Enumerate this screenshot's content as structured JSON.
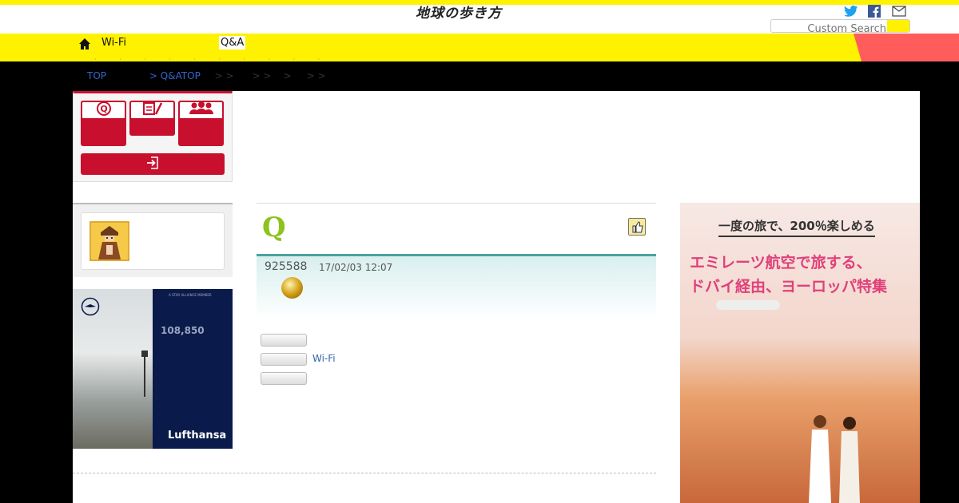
{
  "header": {
    "logo": "地球の歩き方",
    "search_placeholder": "Custom Search"
  },
  "nav": {
    "wifi": "Wi-Fi",
    "qa": "Q&A",
    "dots": "· · · · · · · · · ·"
  },
  "breadcrumb": {
    "top": "TOP",
    "qa_top": "> Q&ATOP",
    "rest": "> >      > >    >     > >"
  },
  "question": {
    "letter": "Q",
    "id": "925588",
    "date": "17/02/03 12:07",
    "tag_link": "Wi-Fi"
  },
  "ad_left": {
    "number": "108,850",
    "brand": "Lufthansa",
    "member": "A STAR ALLIANCE MEMBER"
  },
  "ad_right": {
    "headline": "一度の旅で、200％楽しめる",
    "line1": "エミレーツ航空で旅する、",
    "line2": "ドバイ経由、ヨーロッパ特集"
  },
  "colors": {
    "yellow": "#fff200",
    "red": "#c8102e",
    "teal": "#4aa3a0",
    "green": "#8dc21f"
  }
}
